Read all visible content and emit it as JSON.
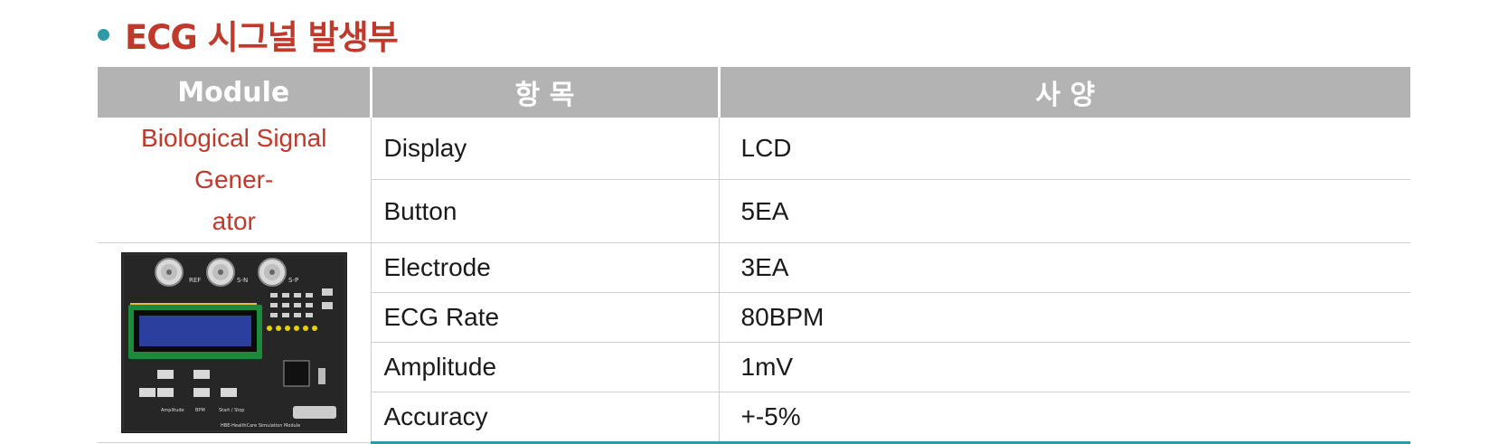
{
  "section": {
    "title": "ECG 시그널 발생부"
  },
  "table": {
    "headers": {
      "module": "Module",
      "item": "항 목",
      "spec": "사 양"
    },
    "module_name": "Biological Signal Gener-\nator",
    "rows": [
      {
        "item": "Display",
        "spec": "LCD"
      },
      {
        "item": "Button",
        "spec": "5EA"
      },
      {
        "item": "Electrode",
        "spec": "3EA"
      },
      {
        "item": "ECG Rate",
        "spec": "80BPM"
      },
      {
        "item": "Amplitude",
        "spec": "1mV"
      },
      {
        "item": "Accuracy",
        "spec": "+-5%"
      }
    ]
  },
  "board": {
    "connectors": [
      "REF",
      "S-N",
      "S-P"
    ],
    "buttons": [
      "Amplitude",
      "BPM",
      "Start / Stop"
    ],
    "footer": "HBE-HealthCare  Simulation Module"
  },
  "colors": {
    "accent_red": "#c0392b",
    "accent_teal": "#2e9aa5",
    "header_gray": "#b3b3b3"
  }
}
